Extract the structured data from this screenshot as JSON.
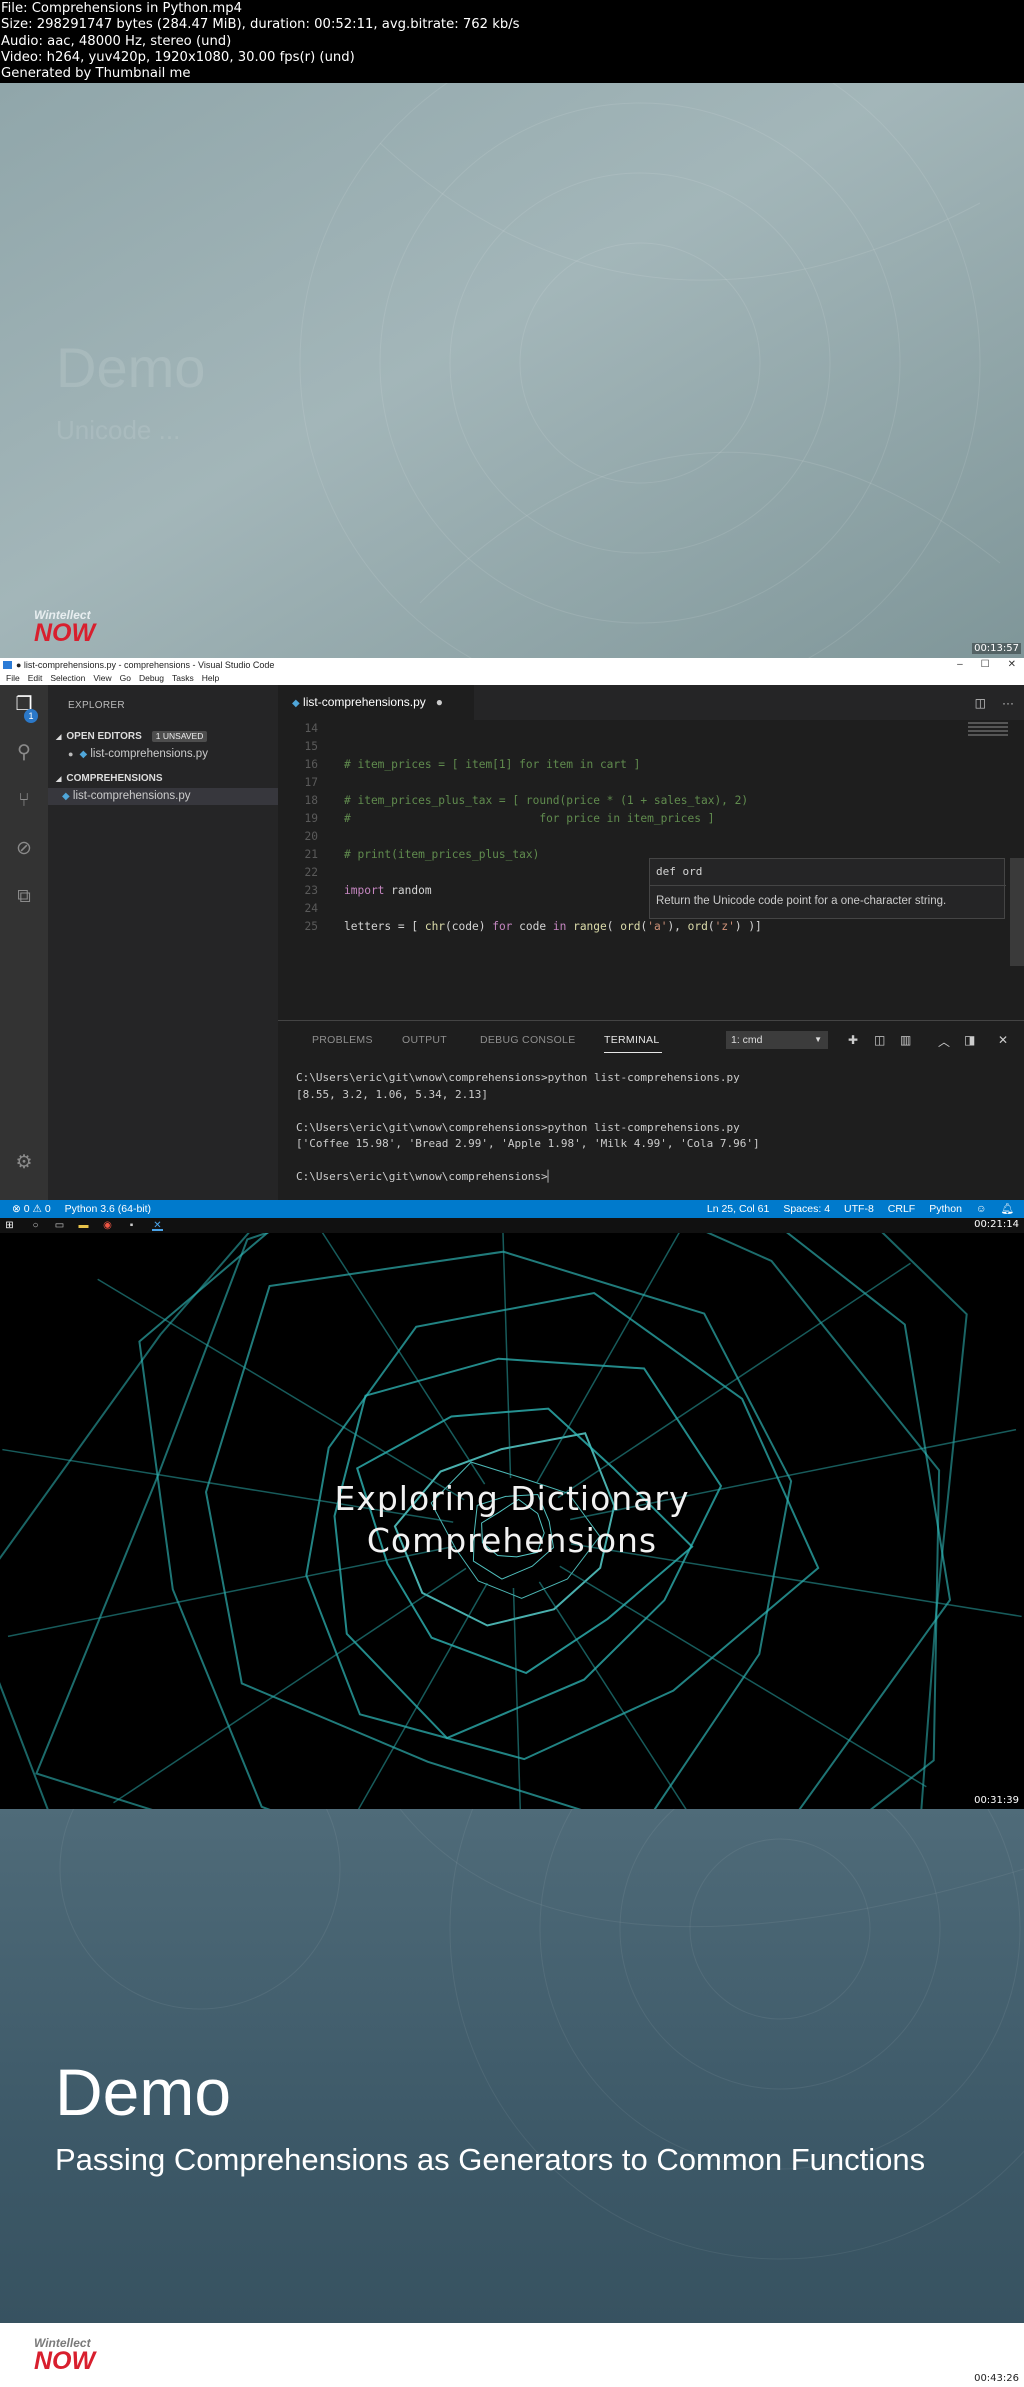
{
  "info": {
    "lines": [
      "File: Comprehensions in Python.mp4",
      "Size: 298291747 bytes (284.47 MiB), duration: 00:52:11, avg.bitrate: 762 kb/s",
      "Audio: aac, 48000 Hz, stereo (und)",
      "Video: h264, yuv420p, 1920x1080, 30.00 fps(r) (und)",
      "Generated by Thumbnail me"
    ]
  },
  "frames": [
    {
      "timestamp": "00:13:57",
      "ghost_title": "Demo",
      "ghost_subtitle": "Unicode ...",
      "logo_top": "Wintellect",
      "logo_bottom": "NOW"
    },
    {
      "timestamp": "00:21:14",
      "window_title": "● list-comprehensions.py - comprehensions - Visual Studio Code",
      "window_controls": [
        "–",
        "☐",
        "✕"
      ],
      "menu": [
        "File",
        "Edit",
        "Selection",
        "View",
        "Go",
        "Debug",
        "Tasks",
        "Help"
      ],
      "activity_badge": "1",
      "sidebar": {
        "header": "EXPLORER",
        "open_editors": "OPEN EDITORS",
        "unsaved_badge": "1 UNSAVED",
        "open_file": "list-comprehensions.py",
        "folder": "COMPREHENSIONS",
        "folder_file": "list-comprehensions.py"
      },
      "tab_label": "list-comprehensions.py",
      "code_lines": [
        {
          "n": "14",
          "t": ""
        },
        {
          "n": "15",
          "t": ""
        },
        {
          "n": "16",
          "t": "# item_prices = [ item[1] for item in cart ]"
        },
        {
          "n": "17",
          "t": ""
        },
        {
          "n": "18",
          "t": "# item_prices_plus_tax = [ round(price * (1 + sales_tax), 2)"
        },
        {
          "n": "19",
          "t": "#                            for price in item_prices ]"
        },
        {
          "n": "20",
          "t": ""
        },
        {
          "n": "21",
          "t": "# print(item_prices_plus_tax)"
        },
        {
          "n": "22",
          "t": ""
        },
        {
          "n": "23",
          "t": "import random"
        },
        {
          "n": "24",
          "t": ""
        },
        {
          "n": "25",
          "t": "letters = [ chr(code) for code in range( ord('a'), ord('z') )]"
        }
      ],
      "hover": {
        "signature": "def ord",
        "doc": "Return the Unicode code point for a one-character string."
      },
      "panel_tabs": [
        "PROBLEMS",
        "OUTPUT",
        "DEBUG CONSOLE",
        "TERMINAL"
      ],
      "terminal_select": "1: cmd",
      "terminal_lines": [
        "C:\\Users\\eric\\git\\wnow\\comprehensions>python list-comprehensions.py",
        "[8.55, 3.2, 1.06, 5.34, 2.13]",
        "",
        "C:\\Users\\eric\\git\\wnow\\comprehensions>python list-comprehensions.py",
        "['Coffee 15.98', 'Bread 2.99', 'Apple 1.98', 'Milk 4.99', 'Cola 7.96']",
        "",
        "C:\\Users\\eric\\git\\wnow\\comprehensions>"
      ],
      "status": {
        "errors": "0",
        "warnings": "0",
        "interpreter": "Python 3.6 (64-bit)",
        "position": "Ln 25, Col 61",
        "spaces": "Spaces: 4",
        "encoding": "UTF-8",
        "eol": "CRLF",
        "language": "Python"
      },
      "accent_color": "#007acc"
    },
    {
      "timestamp": "00:31:39",
      "title_line1": "Exploring Dictionary",
      "title_line2": "Comprehensions"
    },
    {
      "timestamp": "00:43:26",
      "title": "Demo",
      "subtitle": "Passing Comprehensions as Generators to Common Functions",
      "logo_top": "Wintellect",
      "logo_bottom": "NOW"
    }
  ]
}
